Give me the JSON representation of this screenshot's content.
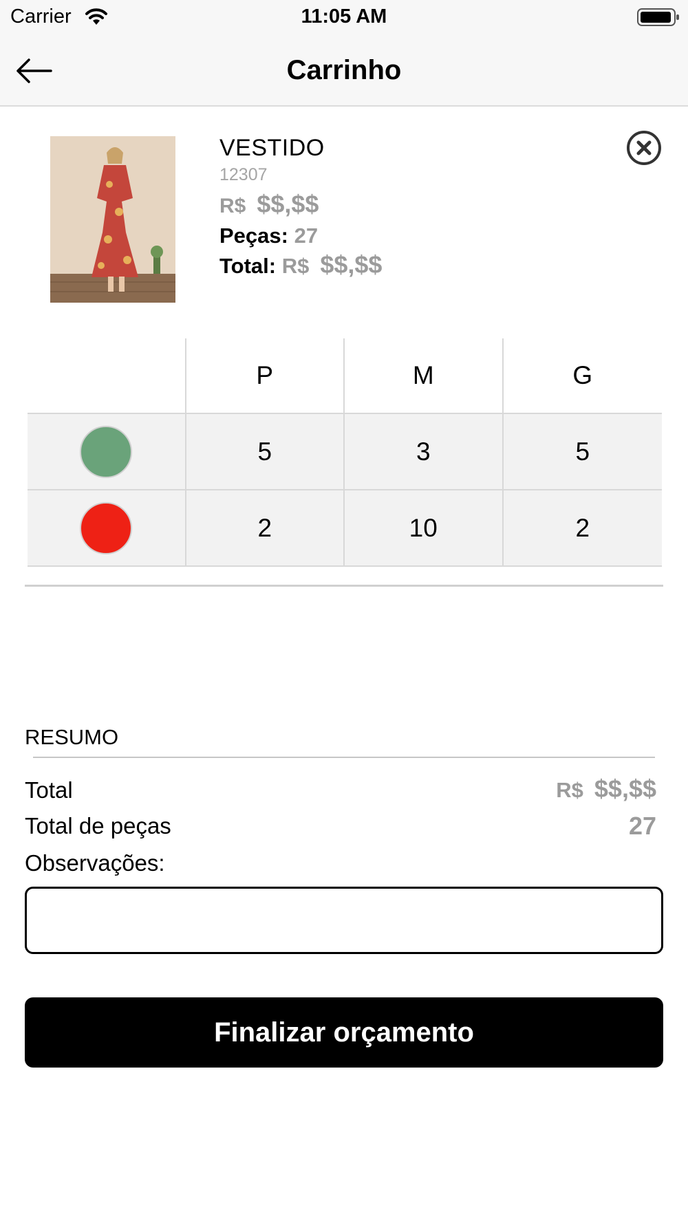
{
  "status_bar": {
    "carrier": "Carrier",
    "time": "11:05 AM"
  },
  "nav": {
    "title": "Carrinho",
    "back_icon": "arrow-left-icon"
  },
  "product": {
    "name": "VESTIDO",
    "code": "12307",
    "price_currency": "R$",
    "price_value": "$$,$$",
    "pieces_label": "Peças:",
    "pieces_value": "27",
    "total_label": "Total:",
    "total_currency": "R$",
    "total_value": "$$,$$",
    "remove_icon": "close-circle-icon"
  },
  "size_grid": {
    "sizes": [
      "P",
      "M",
      "G"
    ],
    "rows": [
      {
        "color": "#6aa37a",
        "quantities": [
          "5",
          "3",
          "5"
        ]
      },
      {
        "color": "#ee2115",
        "quantities": [
          "2",
          "10",
          "2"
        ]
      }
    ]
  },
  "summary": {
    "title": "RESUMO",
    "total_label": "Total",
    "total_currency": "R$",
    "total_value": "$$,$$",
    "pieces_label": "Total de peças",
    "pieces_value": "27",
    "notes_label": "Observações:",
    "notes_value": ""
  },
  "finish_button": {
    "label": "Finalizar orçamento"
  }
}
